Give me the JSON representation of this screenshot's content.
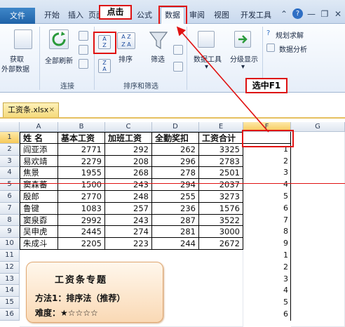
{
  "tabs": {
    "file": "文件",
    "items": [
      "开始",
      "插入",
      "页面布局",
      "公式",
      "数据",
      "审阅",
      "视图",
      "开发工具"
    ],
    "active": "数据"
  },
  "window_controls": {
    "minimize": "—",
    "restore": "❐",
    "close": "✕",
    "help": "?"
  },
  "ribbon": {
    "get_external": [
      "获取",
      "外部数据"
    ],
    "refresh_all": "全部刷新",
    "group_connections": "连接",
    "sort": "排序",
    "filter": "筛选",
    "group_sort_filter": "排序和筛选",
    "data_tools": "数据工具",
    "outline": "分级显示",
    "solver": "规划求解",
    "data_analysis": "数据分析",
    "sort_asc_glyph": "A↓Z",
    "sort_desc_glyph": "Z↓A"
  },
  "annotations": {
    "click": "点击",
    "select_f1": "选中F1"
  },
  "file_tab": {
    "name": "工资条.xlsx",
    "close": "×"
  },
  "sheet": {
    "columns": [
      "A",
      "B",
      "C",
      "D",
      "E",
      "F",
      "G"
    ],
    "header_row": [
      "姓  名",
      "基本工资",
      "加班工资",
      "全勤奖扣",
      "工资合计"
    ],
    "rows": [
      [
        "阎亚添",
        "2771",
        "292",
        "262",
        "3325"
      ],
      [
        "易欢靖",
        "2279",
        "208",
        "296",
        "2783"
      ],
      [
        "焦景",
        "1955",
        "268",
        "278",
        "2501"
      ],
      [
        "窦森蕃",
        "1500",
        "243",
        "294",
        "2037"
      ],
      [
        "殷郎",
        "2770",
        "248",
        "255",
        "3273"
      ],
      [
        "鲁键",
        "1083",
        "257",
        "236",
        "1576"
      ],
      [
        "窦泉孬",
        "2992",
        "243",
        "287",
        "3522"
      ],
      [
        "吴申虎",
        "2445",
        "274",
        "281",
        "3000"
      ],
      [
        "朱成斗",
        "2205",
        "223",
        "244",
        "2672"
      ]
    ],
    "row_numbers": [
      "1",
      "2",
      "3",
      "4",
      "5",
      "6",
      "7",
      "8",
      "9",
      "10",
      "11",
      "12",
      "13",
      "14",
      "15",
      "16"
    ],
    "f_values": [
      "1",
      "2",
      "3",
      "4",
      "5",
      "6",
      "7",
      "8",
      "9",
      "1",
      "2",
      "3",
      "4",
      "5",
      "6"
    ]
  },
  "info_box": {
    "title": "工资条专题",
    "method": "方法1：排序法（推荐）",
    "difficulty": "难度：★☆☆☆☆"
  },
  "colors": {
    "annotation_red": "#e01212",
    "header_fill": "#3f87c9"
  }
}
